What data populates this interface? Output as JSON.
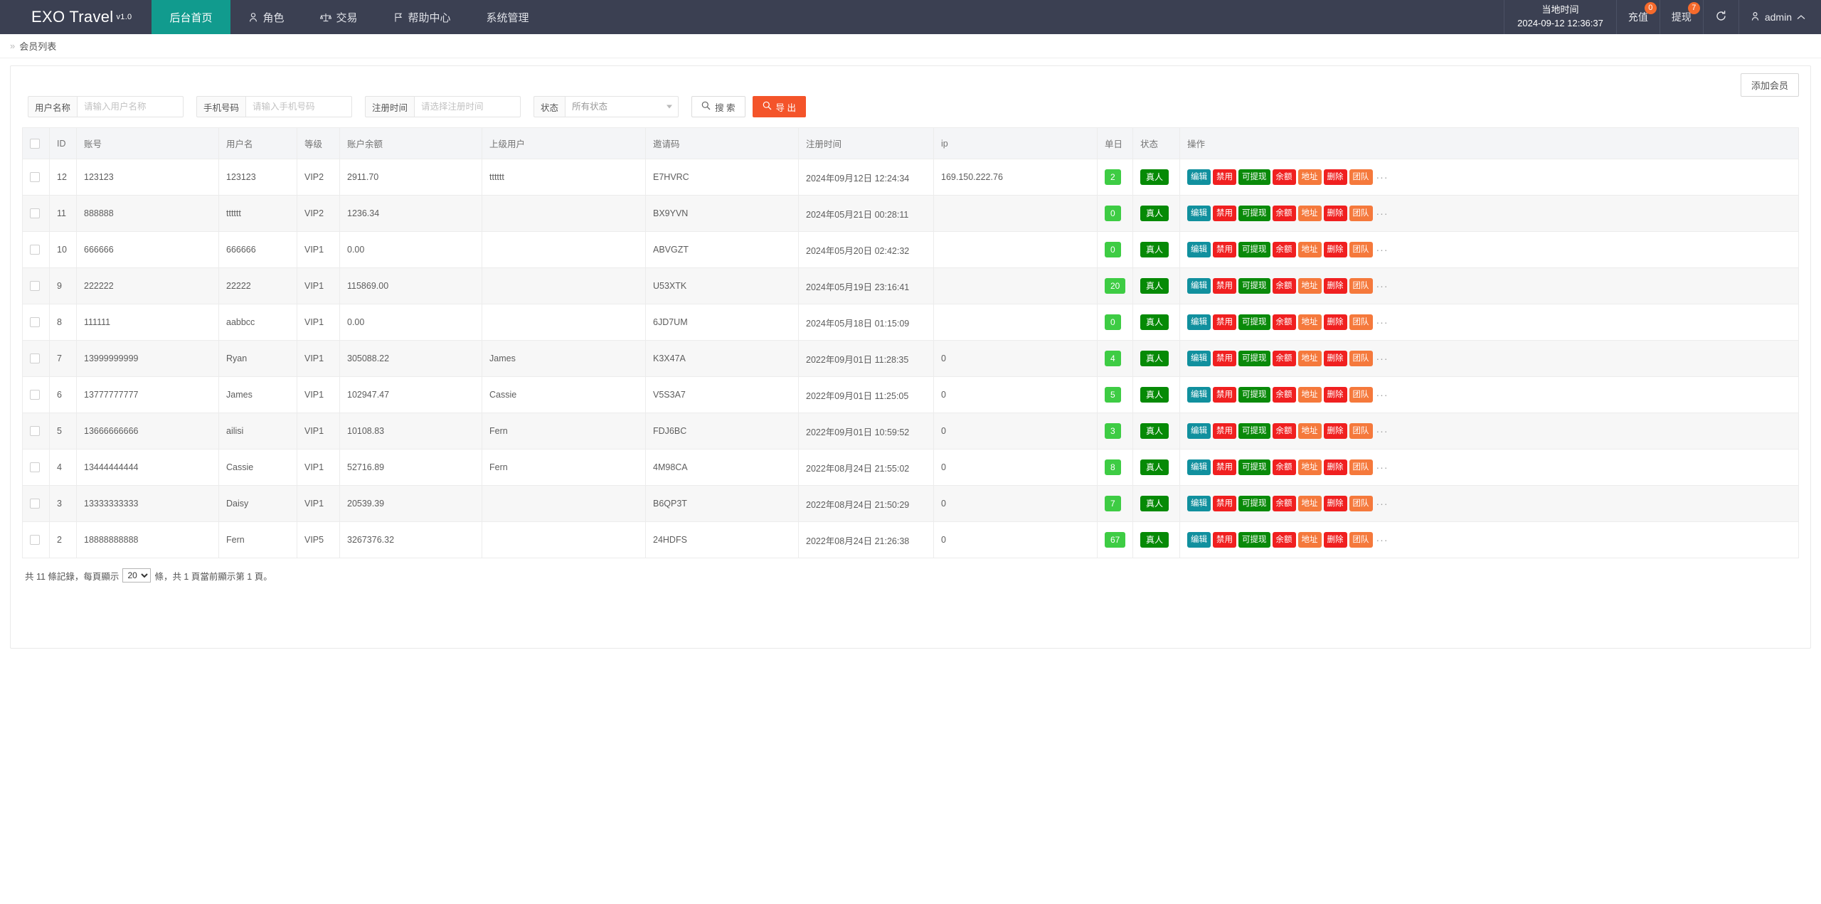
{
  "header": {
    "brand": "EXO Travel",
    "brand_version": "v1.0",
    "nav": [
      {
        "label": "后台首页",
        "icon": "",
        "active": true
      },
      {
        "label": "角色",
        "icon": "user-icon",
        "active": false
      },
      {
        "label": "交易",
        "icon": "scales-icon",
        "active": false
      },
      {
        "label": "帮助中心",
        "icon": "flag-icon",
        "active": false
      },
      {
        "label": "系统管理",
        "icon": "",
        "active": false
      }
    ],
    "local_time_label": "当地时间",
    "local_time_value": "2024-09-12 12:36:37",
    "recharge_label": "充值",
    "recharge_badge": "0",
    "withdraw_label": "提现",
    "withdraw_badge": "7",
    "refresh_icon": "refresh-icon",
    "user_name": "admin",
    "accent_color": "#119b8e",
    "badge_color": "#f56a2c",
    "topbar_color": "#3b4052"
  },
  "breadcrumb": {
    "arrow": "»",
    "title": "会员列表"
  },
  "toolbar": {
    "add_member_label": "添加会员"
  },
  "filters": {
    "username_label": "用户名称",
    "username_placeholder": "请输入用户名称",
    "username_value": "",
    "phone_label": "手机号码",
    "phone_placeholder": "请输入手机号码",
    "phone_value": "",
    "regtime_label": "注册时间",
    "regtime_placeholder": "请选择注册时间",
    "regtime_value": "",
    "status_label": "状态",
    "status_selected": "所有状态",
    "status_options": [
      "所有状态"
    ],
    "search_label": "搜 索",
    "search_icon": "search-icon",
    "export_label": "导 出",
    "export_icon": "search-icon"
  },
  "table": {
    "columns": [
      "",
      "ID",
      "账号",
      "用户名",
      "等级",
      "账户余额",
      "上级用户",
      "邀请码",
      "注册时间",
      "ip",
      "单日",
      "状态",
      "操作"
    ],
    "op_buttons": [
      "编辑",
      "禁用",
      "可提现",
      "余额",
      "地址",
      "删除",
      "团队"
    ],
    "op_more": "···",
    "rows": [
      {
        "id": "12",
        "account": "123123",
        "username": "123123",
        "level": "VIP2",
        "balance": "2911.70",
        "parent": "tttttt",
        "invite": "E7HVRC",
        "regtime": "2024年09月12日 12:24:34",
        "ip": "169.150.222.76",
        "daily": "2",
        "status": "真人"
      },
      {
        "id": "11",
        "account": "888888",
        "username": "tttttt",
        "level": "VIP2",
        "balance": "1236.34",
        "parent": "",
        "invite": "BX9YVN",
        "regtime": "2024年05月21日 00:28:11",
        "ip": "",
        "daily": "0",
        "status": "真人"
      },
      {
        "id": "10",
        "account": "666666",
        "username": "666666",
        "level": "VIP1",
        "balance": "0.00",
        "parent": "",
        "invite": "ABVGZT",
        "regtime": "2024年05月20日 02:42:32",
        "ip": "",
        "daily": "0",
        "status": "真人"
      },
      {
        "id": "9",
        "account": "222222",
        "username": "22222",
        "level": "VIP1",
        "balance": "115869.00",
        "parent": "",
        "invite": "U53XTK",
        "regtime": "2024年05月19日 23:16:41",
        "ip": "",
        "daily": "20",
        "status": "真人"
      },
      {
        "id": "8",
        "account": "111111",
        "username": "aabbcc",
        "level": "VIP1",
        "balance": "0.00",
        "parent": "",
        "invite": "6JD7UM",
        "regtime": "2024年05月18日 01:15:09",
        "ip": "",
        "daily": "0",
        "status": "真人"
      },
      {
        "id": "7",
        "account": "13999999999",
        "username": "Ryan",
        "level": "VIP1",
        "balance": "305088.22",
        "parent": "James",
        "invite": "K3X47A",
        "regtime": "2022年09月01日 11:28:35",
        "ip": "0",
        "daily": "4",
        "status": "真人"
      },
      {
        "id": "6",
        "account": "13777777777",
        "username": "James",
        "level": "VIP1",
        "balance": "102947.47",
        "parent": "Cassie",
        "invite": "V5S3A7",
        "regtime": "2022年09月01日 11:25:05",
        "ip": "0",
        "daily": "5",
        "status": "真人"
      },
      {
        "id": "5",
        "account": "13666666666",
        "username": "ailisi",
        "level": "VIP1",
        "balance": "10108.83",
        "parent": "Fern",
        "invite": "FDJ6BC",
        "regtime": "2022年09月01日 10:59:52",
        "ip": "0",
        "daily": "3",
        "status": "真人"
      },
      {
        "id": "4",
        "account": "13444444444",
        "username": "Cassie",
        "level": "VIP1",
        "balance": "52716.89",
        "parent": "Fern",
        "invite": "4M98CA",
        "regtime": "2022年08月24日 21:55:02",
        "ip": "0",
        "daily": "8",
        "status": "真人"
      },
      {
        "id": "3",
        "account": "13333333333",
        "username": "Daisy",
        "level": "VIP1",
        "balance": "20539.39",
        "parent": "",
        "invite": "B6QP3T",
        "regtime": "2022年08月24日 21:50:29",
        "ip": "0",
        "daily": "7",
        "status": "真人"
      },
      {
        "id": "2",
        "account": "18888888888",
        "username": "Fern",
        "level": "VIP5",
        "balance": "3267376.32",
        "parent": "",
        "invite": "24HDFS",
        "regtime": "2022年08月24日 21:26:38",
        "ip": "0",
        "daily": "67",
        "status": "真人"
      }
    ]
  },
  "pagination": {
    "prefix": "共 11 條記錄，每頁顯示",
    "per_page": "20",
    "per_page_options": [
      "20"
    ],
    "suffix": "條，共 1 頁當前顯示第 1 頁。"
  }
}
